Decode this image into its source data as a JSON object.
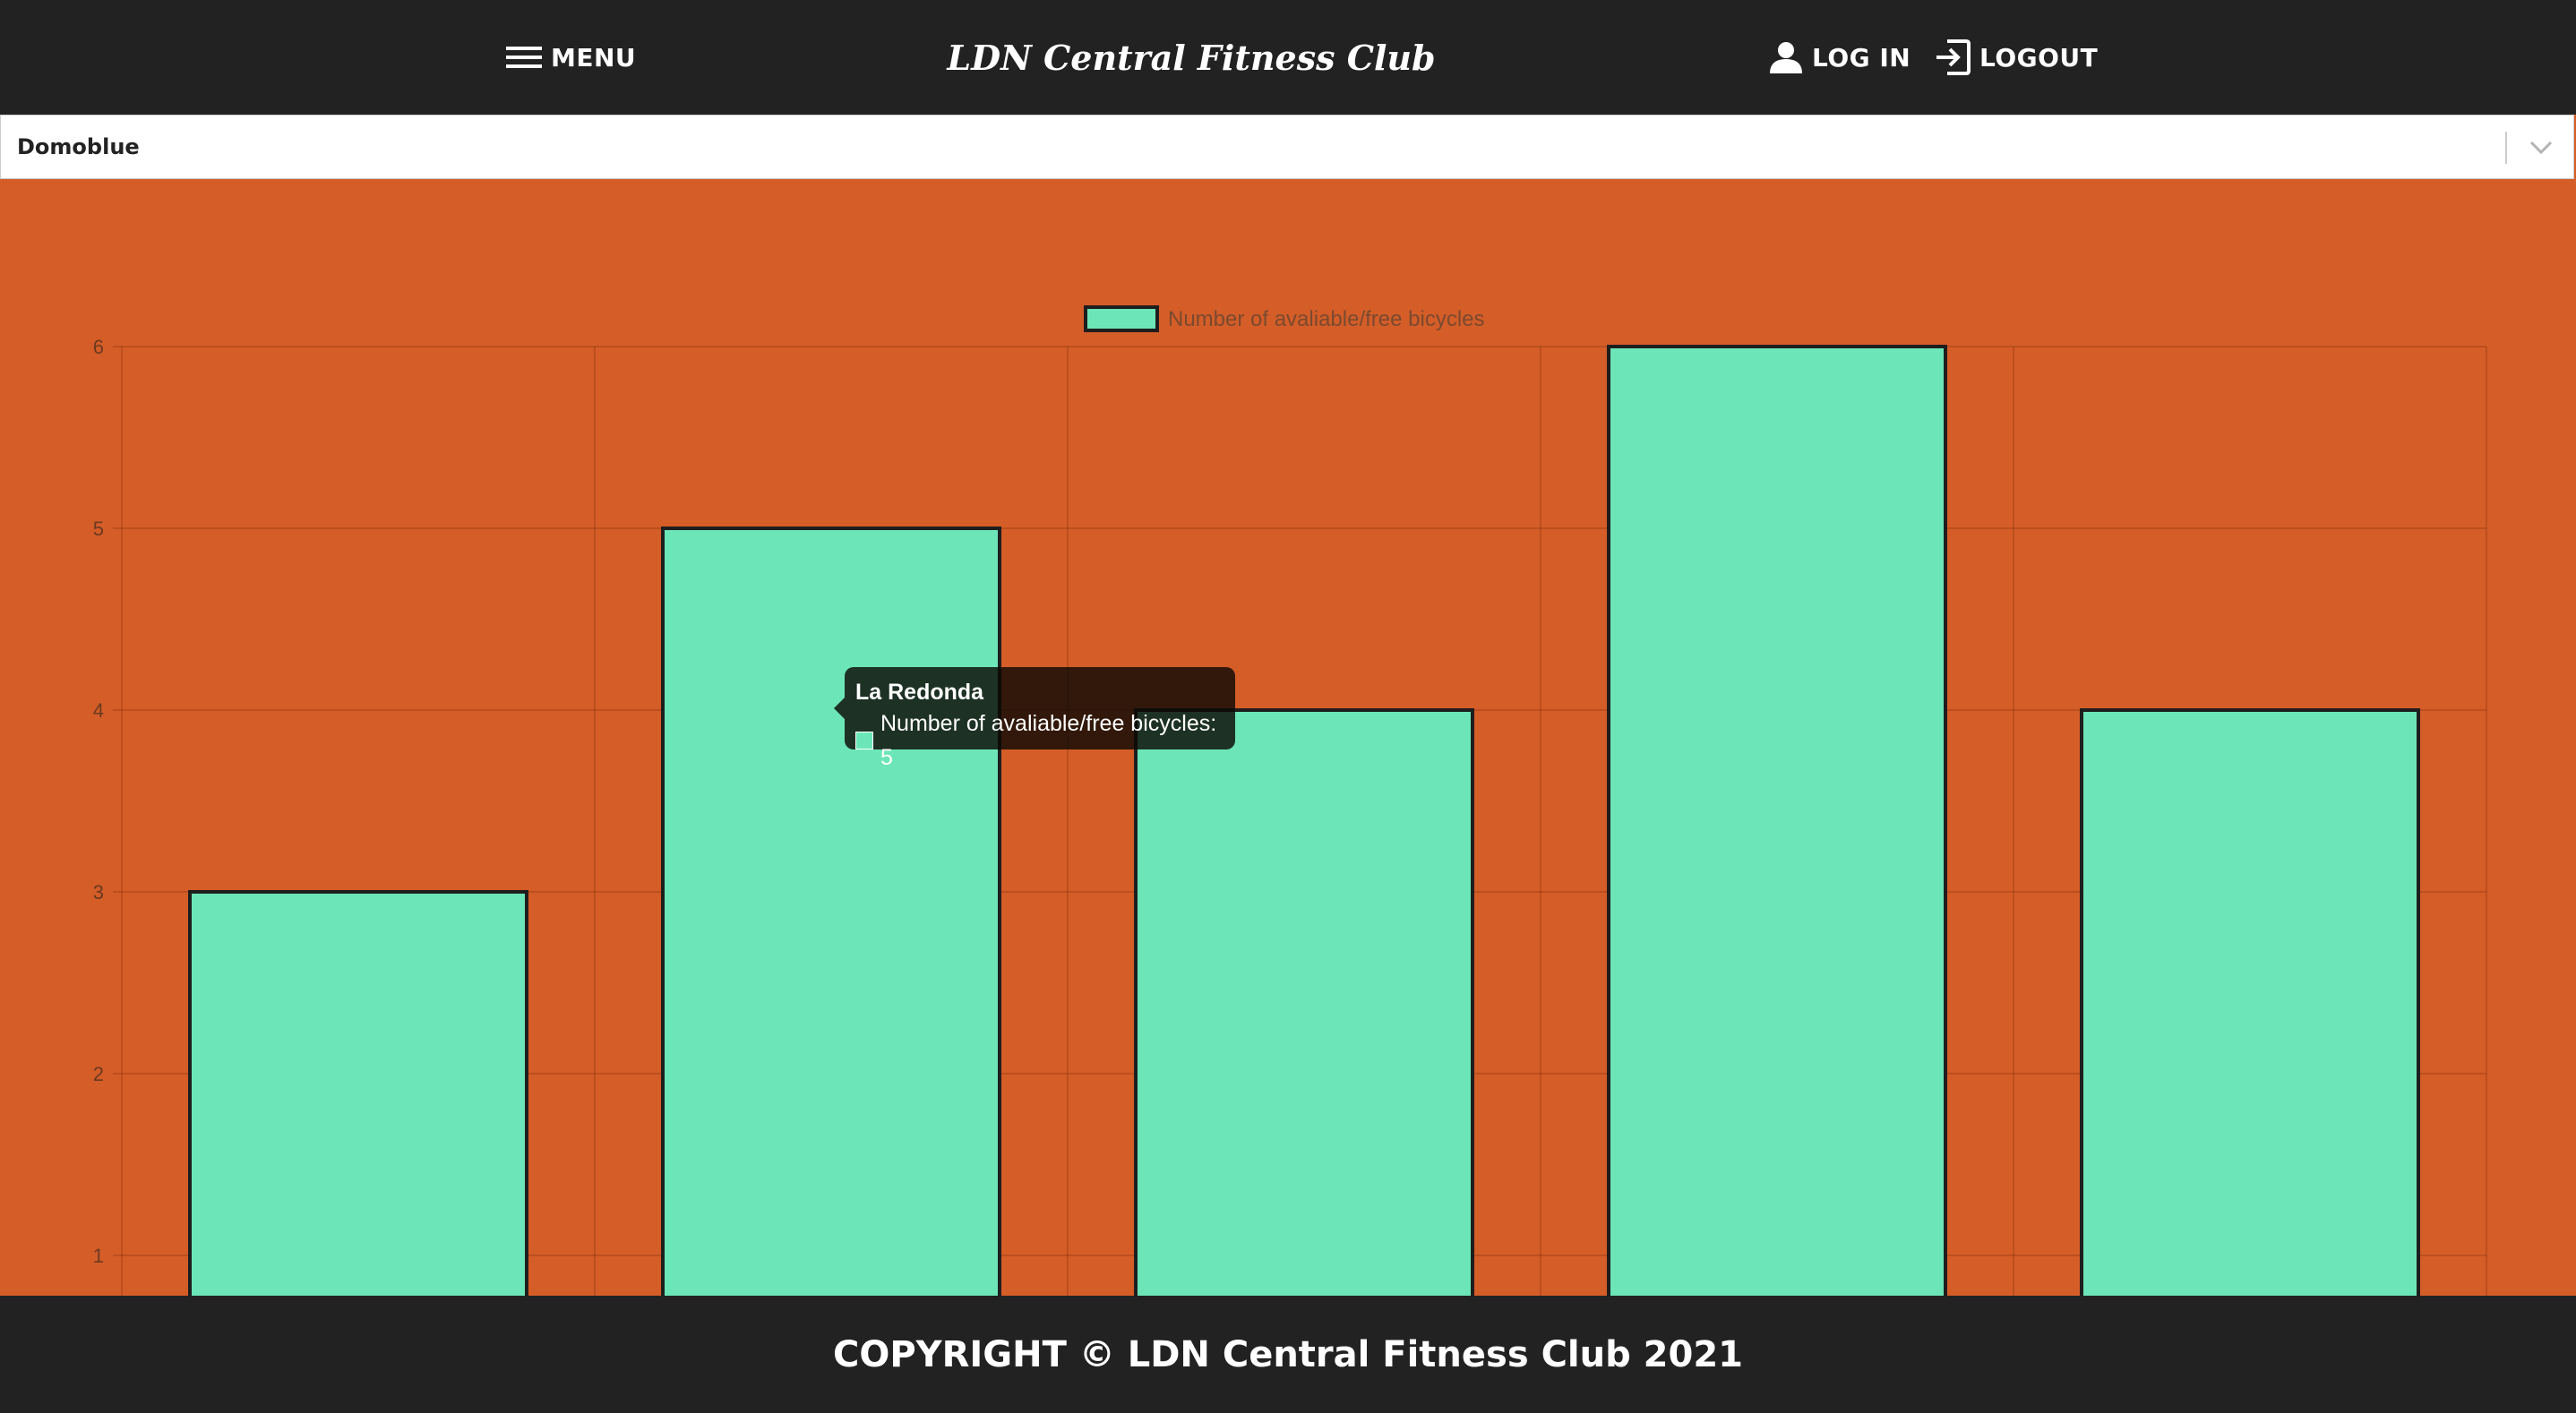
{
  "header": {
    "menu_label": "MENU",
    "brand": "LDN Central Fitness Club",
    "login_label": "LOG IN",
    "logout_label": "LOGOUT"
  },
  "station_select": {
    "selected": "Domoblue"
  },
  "colors": {
    "navbar": "#222222",
    "background": "#d55d27",
    "bar_fill": "#6ce6b8",
    "bar_border": "#1e1e1e"
  },
  "tooltip": {
    "title": "La Redonda",
    "body": "Number of avaliable/free bicycles: 5"
  },
  "chart_data": {
    "type": "bar",
    "categories": [
      "",
      "La Redonda",
      "",
      "",
      ""
    ],
    "series": [
      {
        "name": "Number of avaliable/free bicycles",
        "values": [
          3,
          5,
          4,
          6,
          4
        ]
      }
    ],
    "legend_position": "top",
    "ylim": [
      0,
      6
    ],
    "yticks": [
      1,
      2,
      3,
      4,
      5,
      6
    ],
    "grid": true
  },
  "footer": {
    "copyright": "COPYRIGHT © LDN Central Fitness Club 2021"
  }
}
